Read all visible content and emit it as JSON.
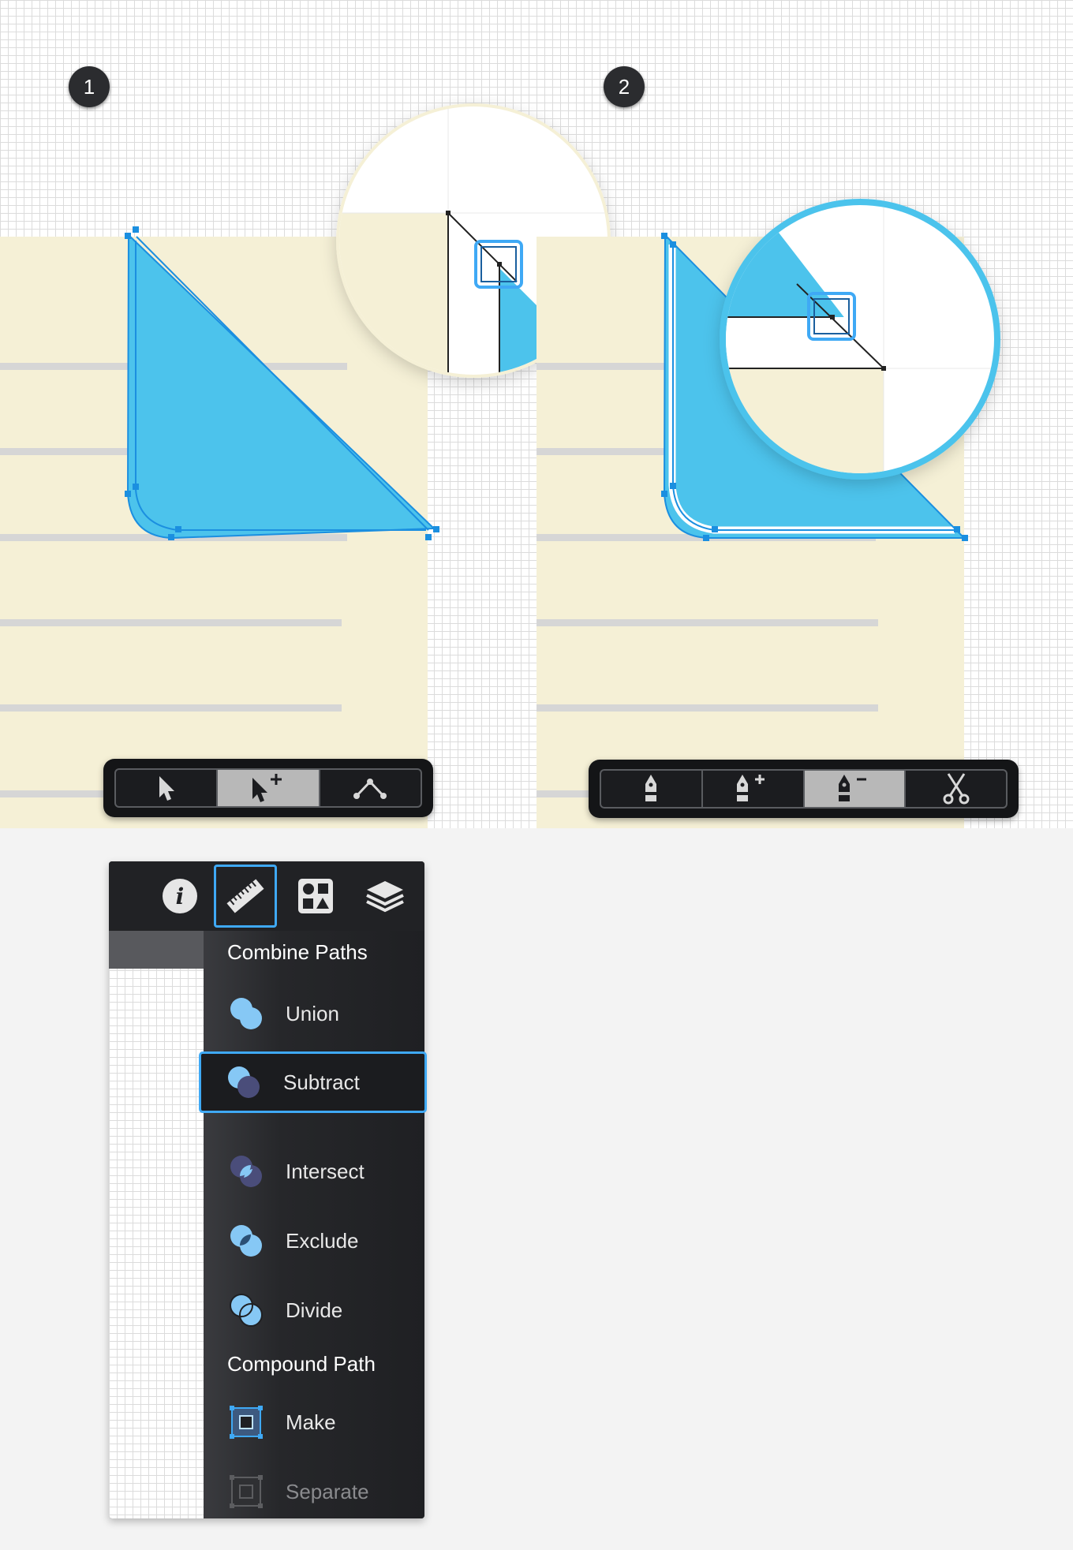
{
  "steps": {
    "one": "1",
    "two": "2"
  },
  "colors": {
    "accent": "#3fa9f5",
    "shape_fill": "#4cc3ec",
    "paper": "#f5f0d6"
  },
  "toolbar_left": {
    "tools": [
      {
        "name": "selection-tool",
        "icon": "arrow-icon",
        "active": false
      },
      {
        "name": "subselection-tool",
        "icon": "arrow-plus-icon",
        "active": true
      },
      {
        "name": "convert-point-tool",
        "icon": "anchor-point-icon",
        "active": false
      }
    ]
  },
  "toolbar_right": {
    "tools": [
      {
        "name": "pen-tool",
        "icon": "pen-icon",
        "active": false
      },
      {
        "name": "add-point-tool",
        "icon": "pen-plus-icon",
        "active": false
      },
      {
        "name": "delete-point-tool",
        "icon": "pen-minus-icon",
        "active": true
      },
      {
        "name": "scissors-tool",
        "icon": "scissors-icon",
        "active": false
      }
    ]
  },
  "inspector": {
    "tabs": [
      {
        "name": "info-tab",
        "icon": "info-icon"
      },
      {
        "name": "ruler-tab",
        "icon": "ruler-icon",
        "active": true
      },
      {
        "name": "shapes-tab",
        "icon": "shapes-icon"
      },
      {
        "name": "layers-tab",
        "icon": "layers-icon"
      }
    ],
    "combine_title": "Combine Paths",
    "combine_ops": [
      {
        "label": "Union",
        "icon": "union-icon"
      },
      {
        "label": "Subtract",
        "icon": "subtract-icon",
        "selected": true
      },
      {
        "label": "Intersect",
        "icon": "intersect-icon"
      },
      {
        "label": "Exclude",
        "icon": "exclude-icon"
      },
      {
        "label": "Divide",
        "icon": "divide-icon"
      }
    ],
    "compound_title": "Compound Path",
    "compound_ops": [
      {
        "label": "Make",
        "icon": "make-compound-icon",
        "enabled": true
      },
      {
        "label": "Separate",
        "icon": "separate-compound-icon",
        "enabled": false
      }
    ]
  }
}
